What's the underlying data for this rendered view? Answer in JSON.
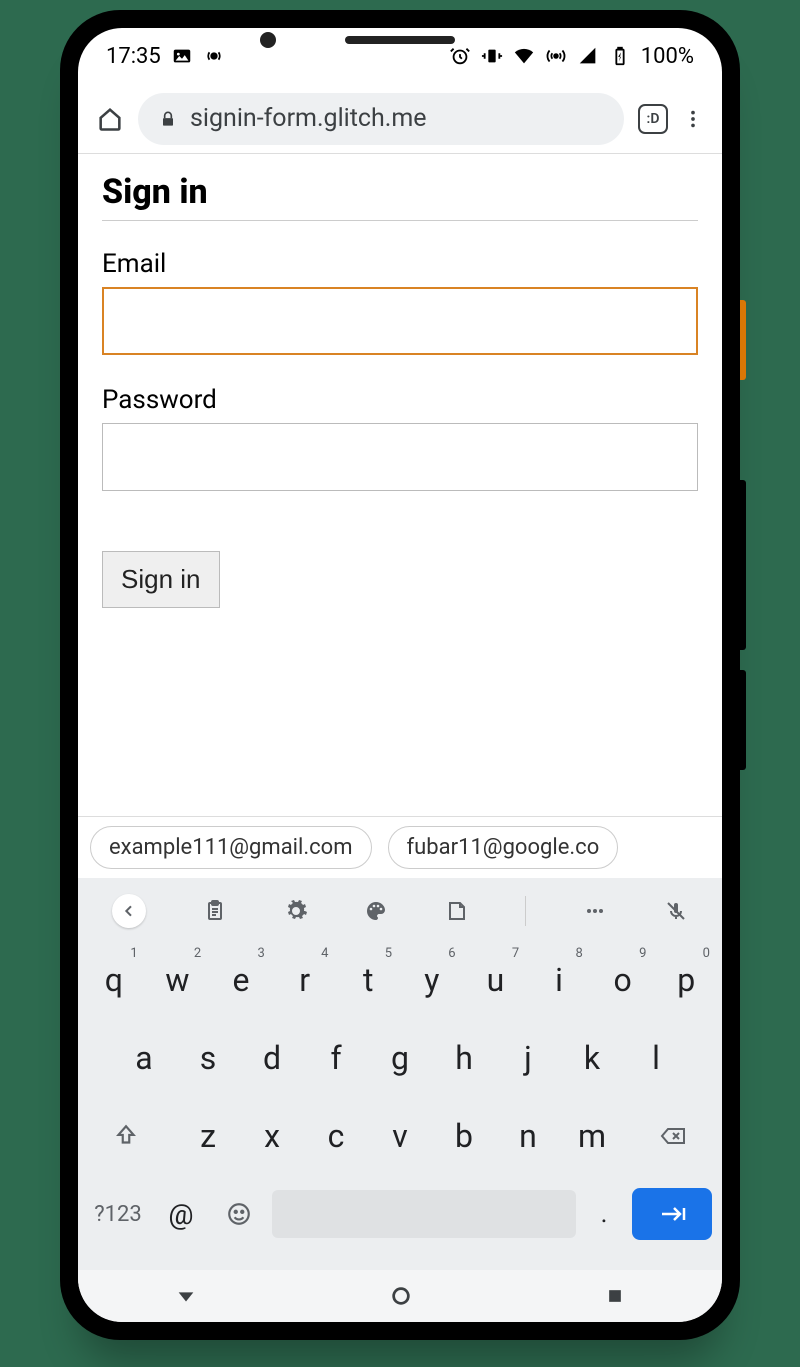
{
  "statusbar": {
    "time": "17:35",
    "battery": "100%"
  },
  "browser": {
    "url": "signin-form.glitch.me",
    "tab_count": ":D"
  },
  "page": {
    "heading": "Sign in",
    "email_label": "Email",
    "password_label": "Password",
    "submit_label": "Sign in"
  },
  "suggestions": [
    "example111@gmail.com",
    "fubar11@google.co"
  ],
  "keyboard": {
    "row1": [
      {
        "k": "q",
        "s": "1"
      },
      {
        "k": "w",
        "s": "2"
      },
      {
        "k": "e",
        "s": "3"
      },
      {
        "k": "r",
        "s": "4"
      },
      {
        "k": "t",
        "s": "5"
      },
      {
        "k": "y",
        "s": "6"
      },
      {
        "k": "u",
        "s": "7"
      },
      {
        "k": "i",
        "s": "8"
      },
      {
        "k": "o",
        "s": "9"
      },
      {
        "k": "p",
        "s": "0"
      }
    ],
    "row2": [
      "a",
      "s",
      "d",
      "f",
      "g",
      "h",
      "j",
      "k",
      "l"
    ],
    "row3": [
      "z",
      "x",
      "c",
      "v",
      "b",
      "n",
      "m"
    ],
    "sym_label": "?123",
    "at_label": "@",
    "dot_label": "."
  }
}
